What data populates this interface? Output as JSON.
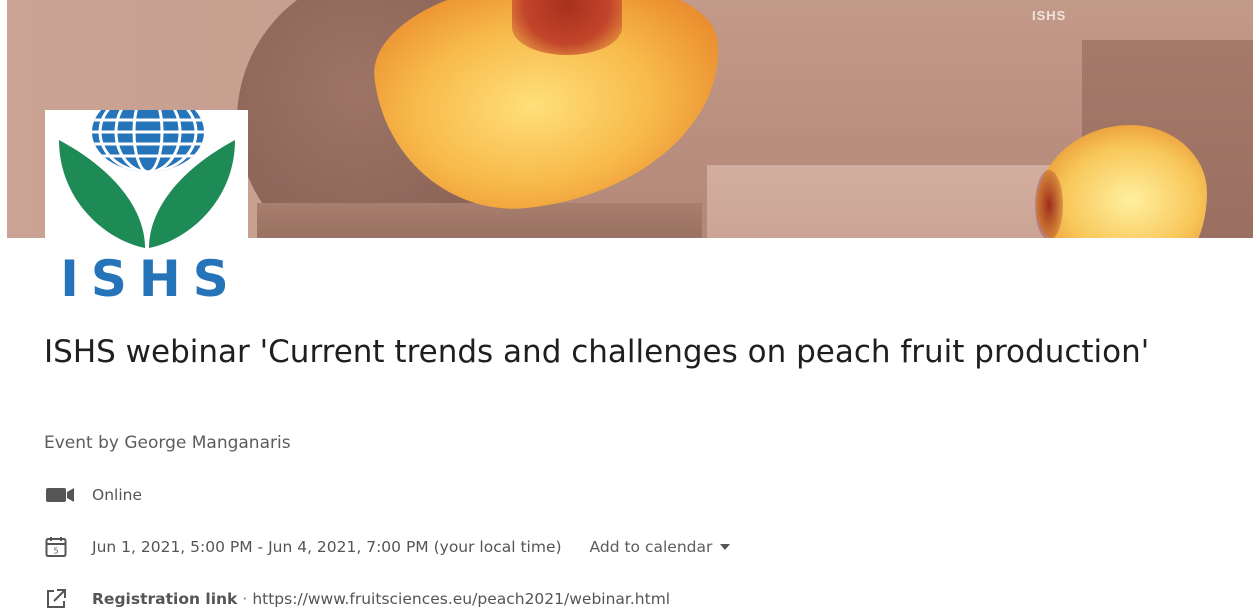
{
  "banner": {
    "tag_text": "ISHS",
    "colors": {
      "background": "#b98e7e",
      "peach": "#f7b94a"
    }
  },
  "logo": {
    "text": "ISHS",
    "colors": {
      "globe": "#2573b8",
      "leaves": "#1e8a55",
      "text": "#2573b8"
    }
  },
  "event": {
    "title": "ISHS webinar 'Current trends and challenges on peach fruit production'",
    "organizer": "Event by George Manganaris",
    "location": {
      "icon": "video-camera-icon",
      "label": "Online"
    },
    "date": {
      "icon": "calendar-icon",
      "text": "Jun 1, 2021, 5:00 PM - Jun 4, 2021, 7:00 PM (your local time)",
      "add_to_calendar_label": "Add to calendar"
    },
    "registration": {
      "icon": "external-link-icon",
      "label": "Registration link",
      "separator": "·",
      "url": "https://www.fruitsciences.eu/peach2021/webinar.html"
    }
  }
}
